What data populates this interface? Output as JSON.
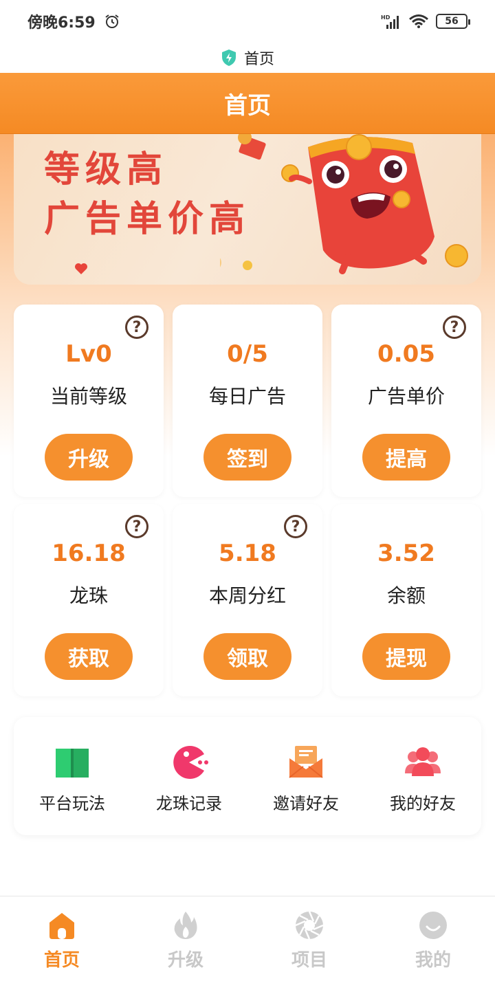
{
  "status_bar": {
    "time": "傍晚6:59",
    "battery": "56"
  },
  "browser": {
    "page_title": "首页"
  },
  "header": {
    "title": "首页"
  },
  "banner": {
    "line1": "等级高",
    "line2": "广告单价高"
  },
  "cards": [
    {
      "value": "Lv0",
      "label": "当前等级",
      "button": "升级",
      "help": "?"
    },
    {
      "value": "0/5",
      "label": "每日广告",
      "button": "签到"
    },
    {
      "value": "0.05",
      "label": "广告单价",
      "button": "提高",
      "help": "?"
    },
    {
      "value": "16.18",
      "label": "龙珠",
      "button": "获取",
      "help": "?"
    },
    {
      "value": "5.18",
      "label": "本周分红",
      "button": "领取",
      "help": "?"
    },
    {
      "value": "3.52",
      "label": "余额",
      "button": "提现"
    }
  ],
  "quick_menu": [
    {
      "label": "平台玩法",
      "icon": "book-icon",
      "color": "#2ecc71"
    },
    {
      "label": "龙珠记录",
      "icon": "pacman-icon",
      "color": "#f0386b"
    },
    {
      "label": "邀请好友",
      "icon": "mail-icon",
      "color": "#f57a3a"
    },
    {
      "label": "我的好友",
      "icon": "group-icon",
      "color": "#f24b5a"
    }
  ],
  "bottom_nav": [
    {
      "label": "首页",
      "icon": "home-icon",
      "active": true
    },
    {
      "label": "升级",
      "icon": "fire-icon",
      "active": false
    },
    {
      "label": "项目",
      "icon": "aperture-icon",
      "active": false
    },
    {
      "label": "我的",
      "icon": "smile-icon",
      "active": false
    }
  ],
  "colors": {
    "accent": "#f58a24",
    "value": "#f07a20",
    "banner_text": "#e2463a"
  }
}
